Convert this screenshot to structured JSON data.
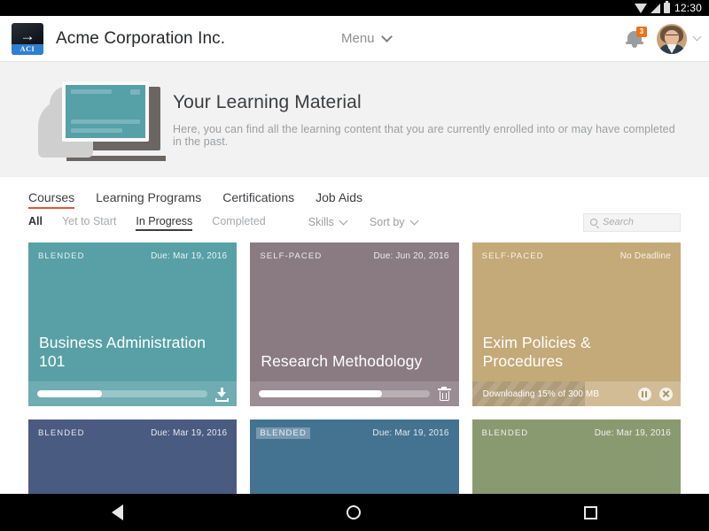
{
  "statusbar": {
    "time": "12:30",
    "icons": [
      "wifi-icon",
      "signal-icon",
      "battery-icon"
    ]
  },
  "header": {
    "logo_arrow": "→",
    "logo_text": "ACI",
    "org_name": "Acme Corporation Inc.",
    "menu_label": "Menu",
    "notification_count": "3",
    "icons": [
      "bell-icon",
      "avatar",
      "chevron-down-icon"
    ]
  },
  "hero": {
    "title": "Your Learning Material",
    "subtitle": "Here, you can find all the learning content that you are currently enrolled into or may have completed in the past.",
    "illustration": "learner-with-screen-illustration",
    "accent_color": "#56a0a8",
    "background": "#f2f2f2"
  },
  "tabs": [
    {
      "label": "Courses",
      "active": true
    },
    {
      "label": "Learning Programs",
      "active": false
    },
    {
      "label": "Certifications",
      "active": false
    },
    {
      "label": "Job Aids",
      "active": false
    }
  ],
  "tab_accent_color": "#e0553c",
  "filters": {
    "chips": [
      {
        "label": "All",
        "state": "bold"
      },
      {
        "label": "Yet to Start",
        "state": "normal"
      },
      {
        "label": "In Progress",
        "state": "selected"
      },
      {
        "label": "Completed",
        "state": "normal"
      }
    ],
    "dropdowns": [
      {
        "label": "Skills"
      },
      {
        "label": "Sort by"
      }
    ]
  },
  "search": {
    "placeholder": "Search",
    "value": "",
    "icon": "search-icon"
  },
  "cards": [
    {
      "type": "BLENDED",
      "due": "Due: Mar 19, 2016",
      "title": "Business Administration 101",
      "color": "#58a0a6",
      "progress": 38,
      "footer_action": "download-icon",
      "type_highlighted": false
    },
    {
      "type": "SELF-PACED",
      "due": "Due: Jun 20, 2016",
      "title": "Research Methodology",
      "color": "#8a7b82",
      "progress": 72,
      "footer_action": "trash-icon",
      "type_highlighted": false
    },
    {
      "type": "SELF-PACED",
      "due": "No Deadline",
      "title": "Exim Policies & Procedures",
      "color": "#c4a979",
      "download_text": "Downloading 15% of 300 MB",
      "download_fill": 54,
      "footer_action": "download-controls",
      "actions": [
        "pause-icon",
        "cancel-icon"
      ],
      "type_highlighted": false
    },
    {
      "type": "BLENDED",
      "due": "Due: Mar 19, 2016",
      "title": "",
      "color": "#4a5b82",
      "type_highlighted": false
    },
    {
      "type": "BLENDED",
      "due": "Due: Mar 19, 2016",
      "title": "",
      "color": "#447291",
      "type_highlighted": true
    },
    {
      "type": "BLENDED",
      "due": "Due: Mar 19, 2016",
      "title": "",
      "color": "#8a9a70",
      "type_highlighted": false
    }
  ],
  "navbar": {
    "back": "back-icon",
    "home": "home-icon",
    "recents": "recents-icon"
  }
}
